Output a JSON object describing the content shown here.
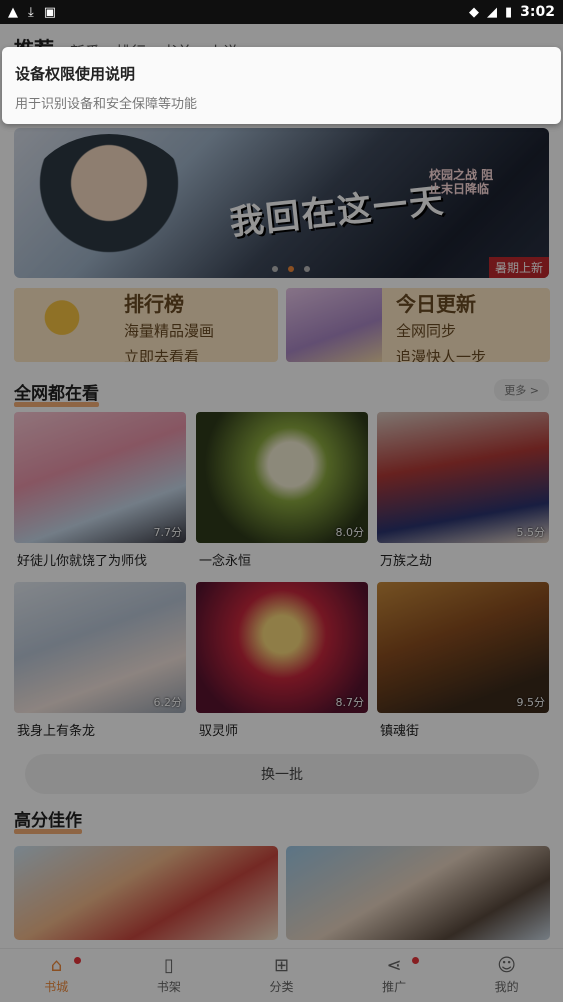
{
  "status_bar": {
    "time": "3:02",
    "left_icons": [
      "warning-icon",
      "download-icon",
      "app-icon"
    ],
    "right_icons": [
      "wifi-icon",
      "signal-icon",
      "battery-icon"
    ]
  },
  "top_nav": {
    "tabs": [
      {
        "label": "推荐",
        "active": true
      },
      {
        "label": "新番"
      },
      {
        "label": "排行"
      },
      {
        "label": "书单"
      },
      {
        "label": "小说"
      }
    ],
    "right_icons": [
      "grid-icon",
      "search-icon"
    ]
  },
  "dialog": {
    "title": "设备权限使用说明",
    "description": "用于识别设备和安全保障等功能"
  },
  "banner": {
    "title": "我回在这一天",
    "subtitle": "校园之战 阻止末日降临",
    "tag": "暑期上新",
    "dots": 3,
    "active_dot": 1
  },
  "promos": [
    {
      "title": "排行榜",
      "line1": "海量精品漫画",
      "line2": "立即去看看"
    },
    {
      "title": "今日更新",
      "line1": "全网同步",
      "line2": "追漫快人一步"
    }
  ],
  "section_popular": {
    "title": "全网都在看",
    "more_label": "更多 >",
    "items": [
      {
        "name": "好徒儿你就饶了为师伐",
        "score": "7.7分"
      },
      {
        "name": "一念永恒",
        "score": "8.0分"
      },
      {
        "name": "万族之劫",
        "score": "5.5分"
      },
      {
        "name": "我身上有条龙",
        "score": "6.2分"
      },
      {
        "name": "驭灵师",
        "score": "8.7分"
      },
      {
        "name": "镇魂街",
        "score": "9.5分"
      }
    ],
    "refresh_label": "换一批"
  },
  "section_high_score": {
    "title": "高分佳作"
  },
  "bottom_nav": [
    {
      "label": "书城",
      "icon": "home-icon",
      "active": true,
      "badge": true
    },
    {
      "label": "书架",
      "icon": "book-icon",
      "active": false,
      "badge": false
    },
    {
      "label": "分类",
      "icon": "category-grid-icon",
      "active": false,
      "badge": false
    },
    {
      "label": "推广",
      "icon": "share-icon",
      "active": false,
      "badge": true
    },
    {
      "label": "我的",
      "icon": "user-icon",
      "active": false,
      "badge": false
    }
  ],
  "colors": {
    "accent": "#f08a3c",
    "badge": "#e8343a",
    "overlay": "rgba(0,0,0,0.42)"
  }
}
